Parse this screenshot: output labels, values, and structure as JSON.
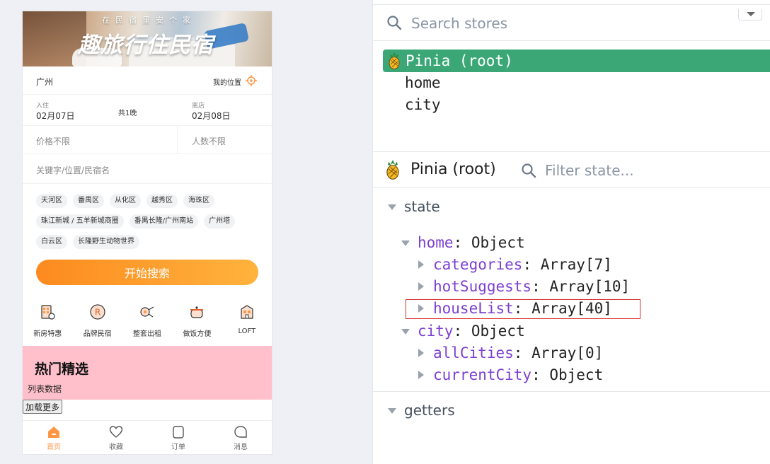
{
  "app": {
    "banner": {
      "subtitle": "在民宿里安个家",
      "title": "趣旅行住民宿"
    },
    "location": {
      "city": "广州",
      "my_location": "我的位置"
    },
    "dates": {
      "checkin_label": "入住",
      "checkin_date": "02月07日",
      "nights": "共1晚",
      "checkout_label": "离店",
      "checkout_date": "02月08日"
    },
    "filters": {
      "price": "价格不限",
      "people": "人数不限"
    },
    "keyword_placeholder": "关键字/位置/民宿名",
    "hot_tags": [
      "天河区",
      "番禺区",
      "从化区",
      "越秀区",
      "海珠区",
      "珠江新城 / 五羊新城商圈",
      "番禺长隆/广州南站",
      "广州塔",
      "白云区",
      "长隆野生动物世界"
    ],
    "search_button": "开始搜索",
    "categories": [
      {
        "label": "新房特惠",
        "icon": "new-house-icon"
      },
      {
        "label": "品牌民宿",
        "icon": "brand-icon"
      },
      {
        "label": "整套出租",
        "icon": "key-icon"
      },
      {
        "label": "做饭方便",
        "icon": "cooking-pot-icon"
      },
      {
        "label": "LOFT",
        "icon": "loft-building-icon"
      }
    ],
    "hot_section": {
      "title": "热门精选",
      "list_text": "列表数据"
    },
    "load_more": "加载更多",
    "tabbar": [
      {
        "label": "首页",
        "icon": "home-icon",
        "active": true
      },
      {
        "label": "收藏",
        "icon": "heart-icon",
        "active": false
      },
      {
        "label": "订单",
        "icon": "order-icon",
        "active": false
      },
      {
        "label": "消息",
        "icon": "message-icon",
        "active": false
      }
    ],
    "colors": {
      "accent": "#ff9645",
      "hot_bg": "#ffc0cb"
    }
  },
  "devtools": {
    "store_search_placeholder": "Search stores",
    "stores": [
      {
        "name": "Pinia (root)",
        "selected": true,
        "icon": "pineapple-icon"
      },
      {
        "name": "home",
        "selected": false
      },
      {
        "name": "city",
        "selected": false
      }
    ],
    "inspector": {
      "title": "Pinia (root)",
      "filter_placeholder": "Filter state...",
      "state_label": "state",
      "getters_label": "getters",
      "home": {
        "key": "home",
        "type": ": Object"
      },
      "categories": {
        "key": "categories",
        "type": ": Array[7]"
      },
      "hotSuggests": {
        "key": "hotSuggests",
        "type": ": Array[10]"
      },
      "houseList": {
        "key": "houseList",
        "type": ": Array[40]"
      },
      "city": {
        "key": "city",
        "type": ": Object"
      },
      "allCities": {
        "key": "allCities",
        "type": ": Array[0]"
      },
      "currentCity": {
        "key": "currentCity",
        "type": ": Object"
      }
    },
    "colors": {
      "selected": "#3ba776",
      "key": "#7c3fd1",
      "highlight": "#d9302f"
    }
  }
}
